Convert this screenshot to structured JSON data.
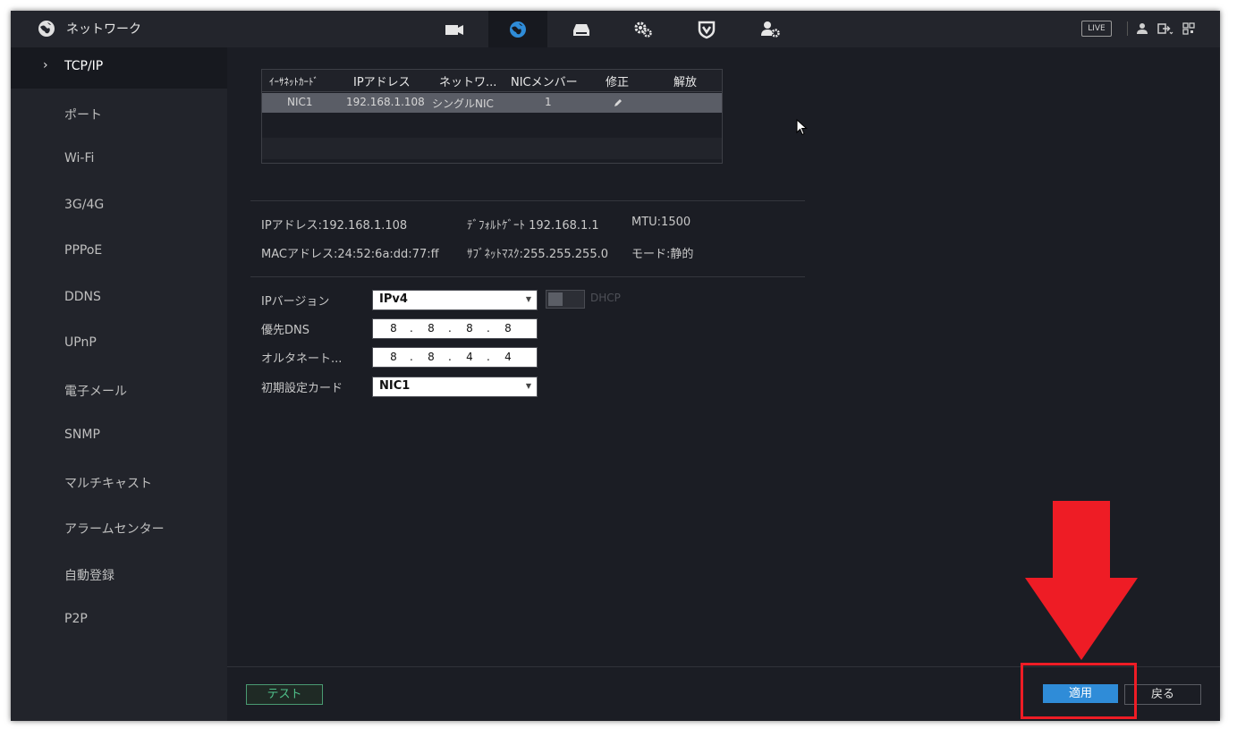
{
  "header": {
    "title": "ネットワーク",
    "nav": [
      {
        "name": "camera-icon",
        "active": false
      },
      {
        "name": "network-globe-icon",
        "active": true
      },
      {
        "name": "storage-icon",
        "active": false
      },
      {
        "name": "system-settings-icon",
        "active": false
      },
      {
        "name": "security-shield-icon",
        "active": false
      },
      {
        "name": "account-settings-icon",
        "active": false
      }
    ],
    "live_label": "LIVE"
  },
  "sidebar": {
    "items": [
      {
        "label": "TCP/IP",
        "active": true
      },
      {
        "label": "ポート"
      },
      {
        "label": "Wi-Fi"
      },
      {
        "label": "3G/4G"
      },
      {
        "label": "PPPoE"
      },
      {
        "label": "DDNS"
      },
      {
        "label": "UPnP"
      },
      {
        "label": "電子メール"
      },
      {
        "label": "SNMP"
      },
      {
        "label": "マルチキャスト"
      },
      {
        "label": "アラームセンター"
      },
      {
        "label": "自動登録"
      },
      {
        "label": "P2P"
      }
    ]
  },
  "nic_table": {
    "headers": [
      "ｲｰｻﾈｯﾄｶｰﾄﾞ",
      "IPアドレス",
      "ネットワ...",
      "NICメンバー",
      "修正",
      "解放"
    ],
    "rows": [
      {
        "card": "NIC1",
        "ip": "192.168.1.108",
        "mode": "シングルNIC",
        "members": "1"
      }
    ]
  },
  "info": {
    "ip": "IPアドレス:192.168.1.108",
    "gateway": "ﾃﾞﾌｫﾙﾄｹﾞｰﾄ 192.168.1.1",
    "mtu": "MTU:1500",
    "mac": "MACアドレス:24:52:6a:dd:77:ff",
    "subnet": "ｻﾌﾞﾈｯﾄﾏｽｸ:255.255.255.0",
    "mode": "モード:静的"
  },
  "form": {
    "ip_version_label": "IPバージョン",
    "ip_version_value": "IPv4",
    "dhcp_label": "DHCP",
    "dhcp_on": false,
    "preferred_dns_label": "優先DNS",
    "preferred_dns": [
      "8",
      "8",
      "8",
      "8"
    ],
    "alternate_dns_label": "オルタネート...",
    "alternate_dns": [
      "8",
      "8",
      "4",
      "4"
    ],
    "default_card_label": "初期設定カード",
    "default_card_value": "NIC1",
    "dot": "."
  },
  "footer": {
    "test_label": "テスト",
    "apply_label": "適用",
    "back_label": "戻る"
  },
  "colors": {
    "annotation_red": "#ee1c25",
    "apply_blue": "#2f8cd8",
    "test_green": "#4fc08a"
  }
}
